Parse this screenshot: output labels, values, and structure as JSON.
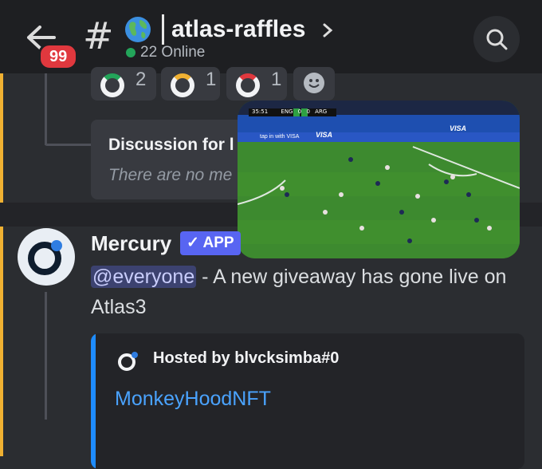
{
  "header": {
    "back_badge": "99",
    "hash": "#",
    "channel_name": "atlas-raffles",
    "online": "22 Online"
  },
  "reactions": [
    {
      "count": "2"
    },
    {
      "count": "1"
    },
    {
      "count": "1"
    }
  ],
  "thread": {
    "title": "Discussion for l",
    "subtitle": "There are no me"
  },
  "video": {
    "score_time": "35:51",
    "team_a": "ENG",
    "team_b": "ARG",
    "score_a": "0",
    "score_b": "0",
    "ad": "VISA",
    "ad_tagline": "tap in with VISA"
  },
  "message": {
    "author": "Mercury",
    "app_badge": "✓ APP",
    "mention": "@everyone",
    "text": " - A new giveaway has gone live on Atlas3"
  },
  "embed": {
    "author": "Hosted by blvcksimba#0",
    "title": "MonkeyHoodNFT",
    "accent": "#1e8cff"
  }
}
